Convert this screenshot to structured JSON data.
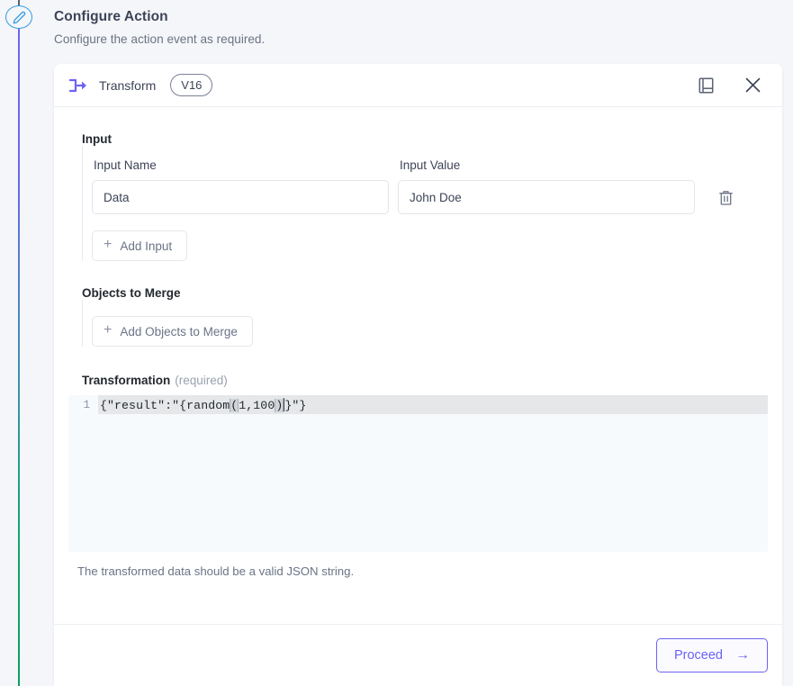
{
  "page": {
    "title": "Configure Action",
    "subtitle": "Configure the action event as required."
  },
  "timeline": {
    "node_icon": "pencil-icon",
    "node_border_color": "#2e9ae0",
    "line_gradient_start": "#6c63f2",
    "line_gradient_end": "#0d9e5f"
  },
  "card": {
    "header": {
      "icon": "transform-icon",
      "icon_color": "#6c63f2",
      "title": "Transform",
      "version_badge": "V16",
      "docs_icon": "book-icon",
      "close_icon": "close-icon"
    },
    "input_section": {
      "label": "Input",
      "col_name_header": "Input Name",
      "col_value_header": "Input Value",
      "rows": [
        {
          "name_value": "Data",
          "name_placeholder": "Input Name",
          "value_value": "John Doe",
          "value_placeholder": "Input Value",
          "delete_icon": "trash-icon"
        }
      ],
      "add_button": "Add Input",
      "add_icon": "plus-icon"
    },
    "objects_section": {
      "label": "Objects to Merge",
      "add_button": "Add Objects to Merge",
      "add_icon": "plus-icon"
    },
    "transformation_section": {
      "label": "Transformation",
      "required_note": "(required)",
      "line_number": "1",
      "code_before": "{\"result\":\"{random",
      "code_open_paren": "(",
      "code_args": "1,100",
      "code_close_paren": ")",
      "code_after": "}\"}",
      "helper_text": "The transformed data should be a valid JSON string."
    },
    "footer": {
      "proceed_label": "Proceed",
      "proceed_arrow": "→",
      "accent_color": "#6c63f2"
    }
  }
}
